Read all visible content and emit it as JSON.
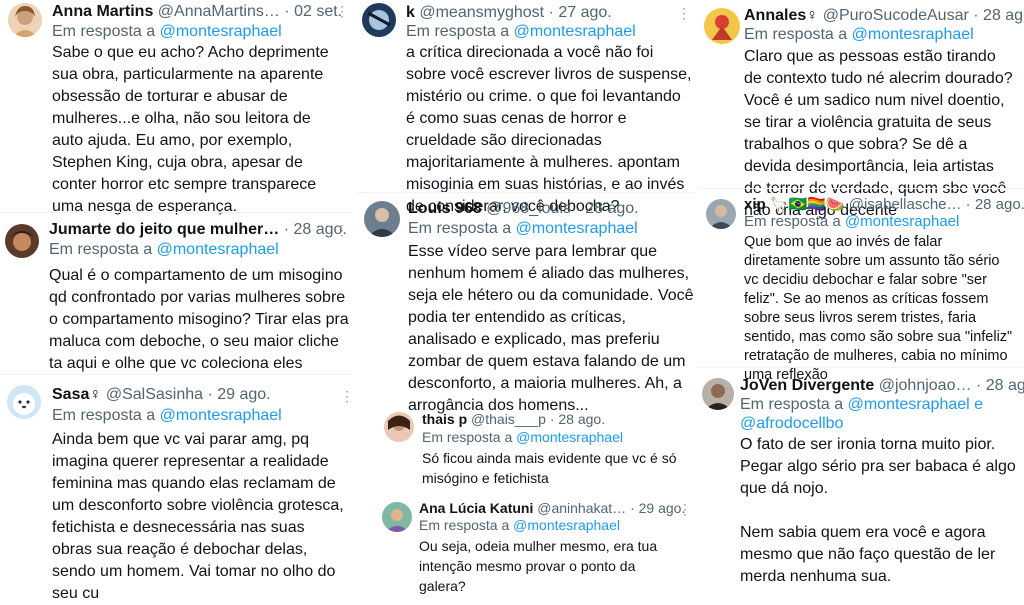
{
  "reply_prefix": "Em resposta a",
  "colors": {
    "accent": "#1d9bf0",
    "secondary_text": "#536471",
    "text": "#0f1419",
    "divider": "#eff3f4"
  },
  "more_icon": "more-horizontal-icon",
  "tweets": [
    {
      "name": "Anna Martins",
      "handle": "@AnnaMartins…",
      "date": "· 02 set.",
      "mentions": [
        "@montesraphael"
      ],
      "text": "Sabe o que eu acho? Acho deprimente sua obra, particularmente na aparente obsessão de torturar e abusar de mulheres...e olha, não sou leitora de auto ajuda. Eu amo, por exemplo, Stephen King, cuja obra, apesar de conter horror etc sempre transparece uma nesga de esperança."
    },
    {
      "name": "Jumarte do jeito que mulher…",
      "handle": "",
      "date": "· 28 ago.",
      "mentions": [
        "@montesraphael"
      ],
      "text": "Qual é o compartamento de um misogino qd confrontado por varias mulheres sobre o compartamento misogino? Tirar elas pra maluca com deboche, o seu maior cliche ta aqui e olhe que vc coleciona eles"
    },
    {
      "name": "Sasa♀",
      "handle": "@SalSasinha",
      "date": "· 29 ago.",
      "mentions": [
        "@montesraphael"
      ],
      "text": "Ainda bem que vc vai parar amg, pq imagina querer representar a realidade feminina mas quando elas reclamam de um desconforto sobre violência grotesca, fetichista e desnecessária nas suas obras sua reação é debochar delas, sendo um homem. Vai tomar no olho do seu cu"
    },
    {
      "name": "k",
      "handle": "@meansmyghost",
      "date": "· 27 ago.",
      "mentions": [
        "@montesraphael"
      ],
      "text": "a crítica direcionada a você não foi sobre você escrever livros de suspense, mistério ou crime. o que foi levantando é como suas cenas de horror e crueldade são direcionadas majoritariamente à mulheres. apontam misoginia em suas histórias, e ao invés de considerar, você debocha?"
    },
    {
      "name": "Louis 968",
      "handle": "@968_louis",
      "date": "· 28 ago.",
      "mentions": [
        "@montesraphael"
      ],
      "text": "Esse vídeo serve para lembrar que nenhum homem é aliado das mulheres, seja ele hétero ou da comunidade. Você podia ter entendido as críticas, analisado e explicado, mas preferiu zombar de quem estava falando de um desconforto, a maioria mulheres. Ah, a arrogância dos homens..."
    },
    {
      "name": "thais p",
      "handle": "@thais___p",
      "date": "· 28 ago.",
      "mentions": [
        "@montesraphael"
      ],
      "text": "Só ficou ainda mais evidente que vc é só misógino e fetichista"
    },
    {
      "name": "Ana Lúcia Katuni",
      "handle": "@aninhakat…",
      "date": "· 29 ago.",
      "mentions": [
        "@montesraphael"
      ],
      "text": "Ou seja, odeia mulher mesmo, era tua intenção mesmo provar o ponto da galera?"
    },
    {
      "name": "Annales♀",
      "handle": "@PuroSucodeAusar",
      "date": "· 28 ago.",
      "mentions": [
        "@montesraphael"
      ],
      "text": "Claro que as pessoas estão tirando de contexto tudo né alecrim dourado? Você é um sadico num nivel doentio, se tirar a violência gratuita de seus trabalhos o que sobra? Se dê a devida desimportância, leia artistas de terror de verdade, quem sbe você não cria algo decente"
    },
    {
      "name": "xip 🦙🇧🇷🏳️‍🌈🍉",
      "handle": "@isabellasche…",
      "date": "· 28 ago.",
      "mentions": [
        "@montesraphael"
      ],
      "text": "Que bom que ao invés de falar diretamente sobre um assunto tão sério vc decidiu debochar e falar sobre \"ser feliz\". Se ao menos as críticas fossem sobre seus livros serem tristes, faria sentido, mas como são sobre sua \"infeliz\" retratação de mulheres, cabia no mínimo uma reflexão"
    },
    {
      "name": "JoVen Divergente",
      "handle": "@johnjoao…",
      "date": "· 28 ago.",
      "mentions": [
        "@montesraphael",
        "e",
        "@afrodocellbo"
      ],
      "text": "O fato de ser ironia torna muito pior. Pegar algo sério pra ser babaca é algo que dá nojo.\n\nNem sabia quem era você e agora mesmo que não faço questão de ler merda nenhuma sua."
    }
  ]
}
